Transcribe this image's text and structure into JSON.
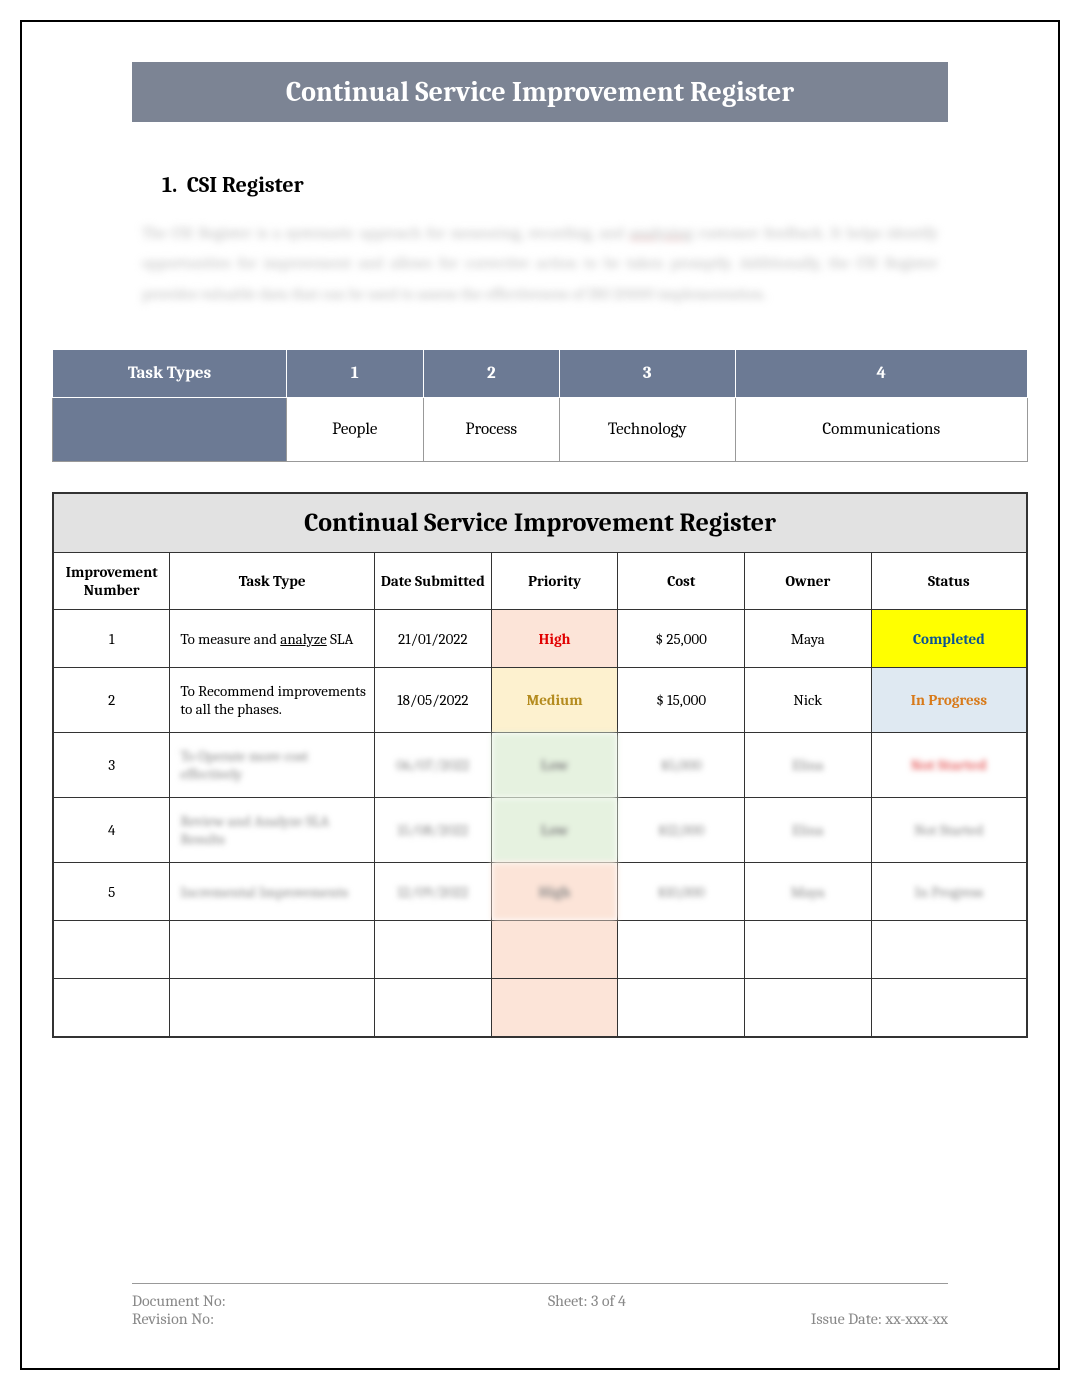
{
  "title": "Continual Service Improvement Register",
  "section": {
    "number": "1.",
    "heading": "CSI Register"
  },
  "taskTypes": {
    "header": "Task Types",
    "cols": [
      "1",
      "2",
      "3",
      "4"
    ],
    "values": [
      "People",
      "Process",
      "Technology",
      "Communications"
    ]
  },
  "csi": {
    "tableTitle": "Continual Service Improvement Register",
    "headers": {
      "number": "Improvement Number",
      "taskType": "Task Type",
      "date": "Date Submitted",
      "priority": "Priority",
      "cost": "Cost",
      "owner": "Owner",
      "status": "Status"
    },
    "rows": [
      {
        "number": "1",
        "taskType": "To measure and analyze SLA",
        "date": "21/01/2022",
        "priority": "High",
        "priorityClass": "priority-high",
        "cost": "$ 25,000",
        "owner": "Maya",
        "status": "Completed",
        "statusClass": "status-completed"
      },
      {
        "number": "2",
        "taskType": "To Recommend improvements to all the phases.",
        "date": "18/05/2022",
        "priority": "Medium",
        "priorityClass": "priority-medium",
        "cost": "$ 15,000",
        "owner": "Nick",
        "status": "In Progress",
        "statusClass": "status-inprogress"
      }
    ]
  },
  "footer": {
    "docNo": "Document No:",
    "sheet": "Sheet: 3 of 4",
    "revNo": "Revision No:",
    "issueDate": "Issue Date: xx-xxx-xx"
  }
}
